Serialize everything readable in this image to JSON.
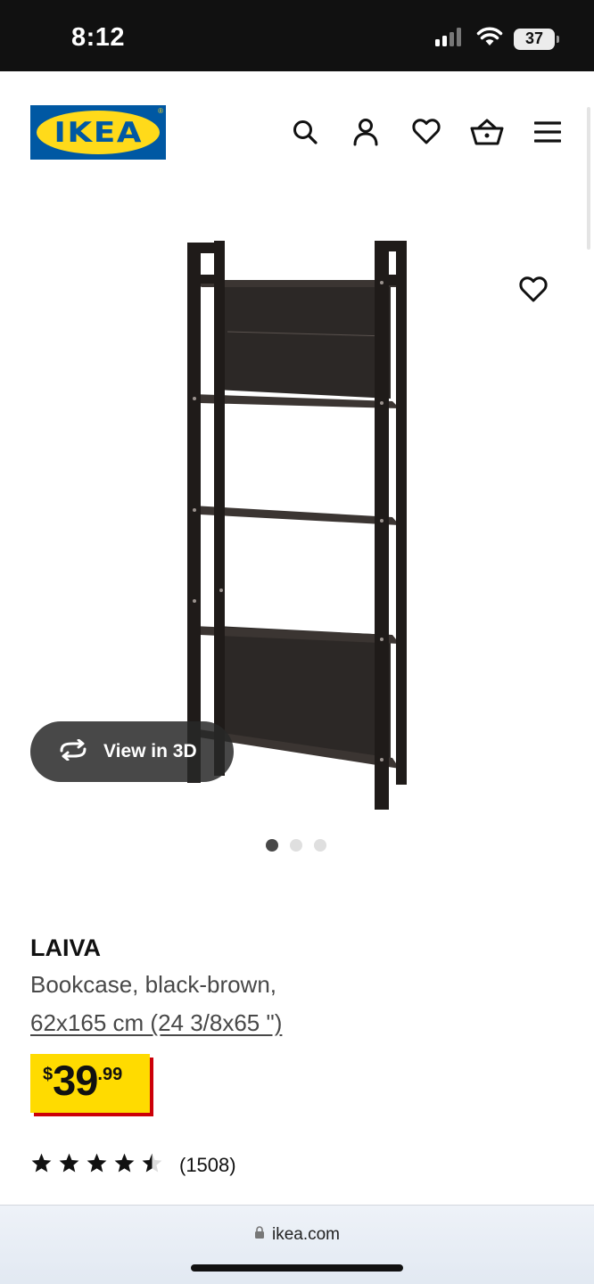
{
  "status_bar": {
    "time": "8:12",
    "battery": "37",
    "icons": [
      "cellular-signal-icon",
      "wifi-icon",
      "battery-icon"
    ]
  },
  "header": {
    "logo_text": "IKEA",
    "logo_reg": "®",
    "icons": [
      "search-icon",
      "account-icon",
      "wishlist-icon",
      "cart-icon",
      "menu-icon"
    ],
    "colors": {
      "logo_blue": "#0058a3",
      "logo_yellow": "#ffda1a"
    }
  },
  "gallery": {
    "view_3d_label": "View in 3D",
    "image_count": 3,
    "active_index": 0
  },
  "product": {
    "name": "LAIVA",
    "description": "Bookcase, black-brown,",
    "size": "62x165 cm (24 3/8x65 \")",
    "price": {
      "currency": "$",
      "integer": "39",
      "decimal": ".99"
    },
    "rating": {
      "stars": 4.5,
      "max": 5,
      "count": "(1508)"
    },
    "colors": {
      "price_yellow": "#ffdb00",
      "price_red": "#cc0008"
    }
  },
  "browser": {
    "url": "ikea.com"
  }
}
